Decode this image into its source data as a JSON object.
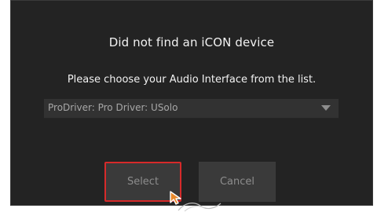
{
  "dialog": {
    "title": "Did not find an iCON device",
    "subtitle": "Please choose your Audio Interface from the list.",
    "dropdown": {
      "selected": "ProDriver: Pro Driver: USolo",
      "icon": "caret-down-icon"
    },
    "buttons": {
      "select_label": "Select",
      "cancel_label": "Cancel"
    }
  },
  "colors": {
    "background": "#232323",
    "text": "#f2f2f2",
    "dropdown_bg": "#323232",
    "button_bg": "#3a3a3a",
    "button_text": "#8d8d8d",
    "highlight": "#d62a2a",
    "cursor": "#e8892b"
  }
}
